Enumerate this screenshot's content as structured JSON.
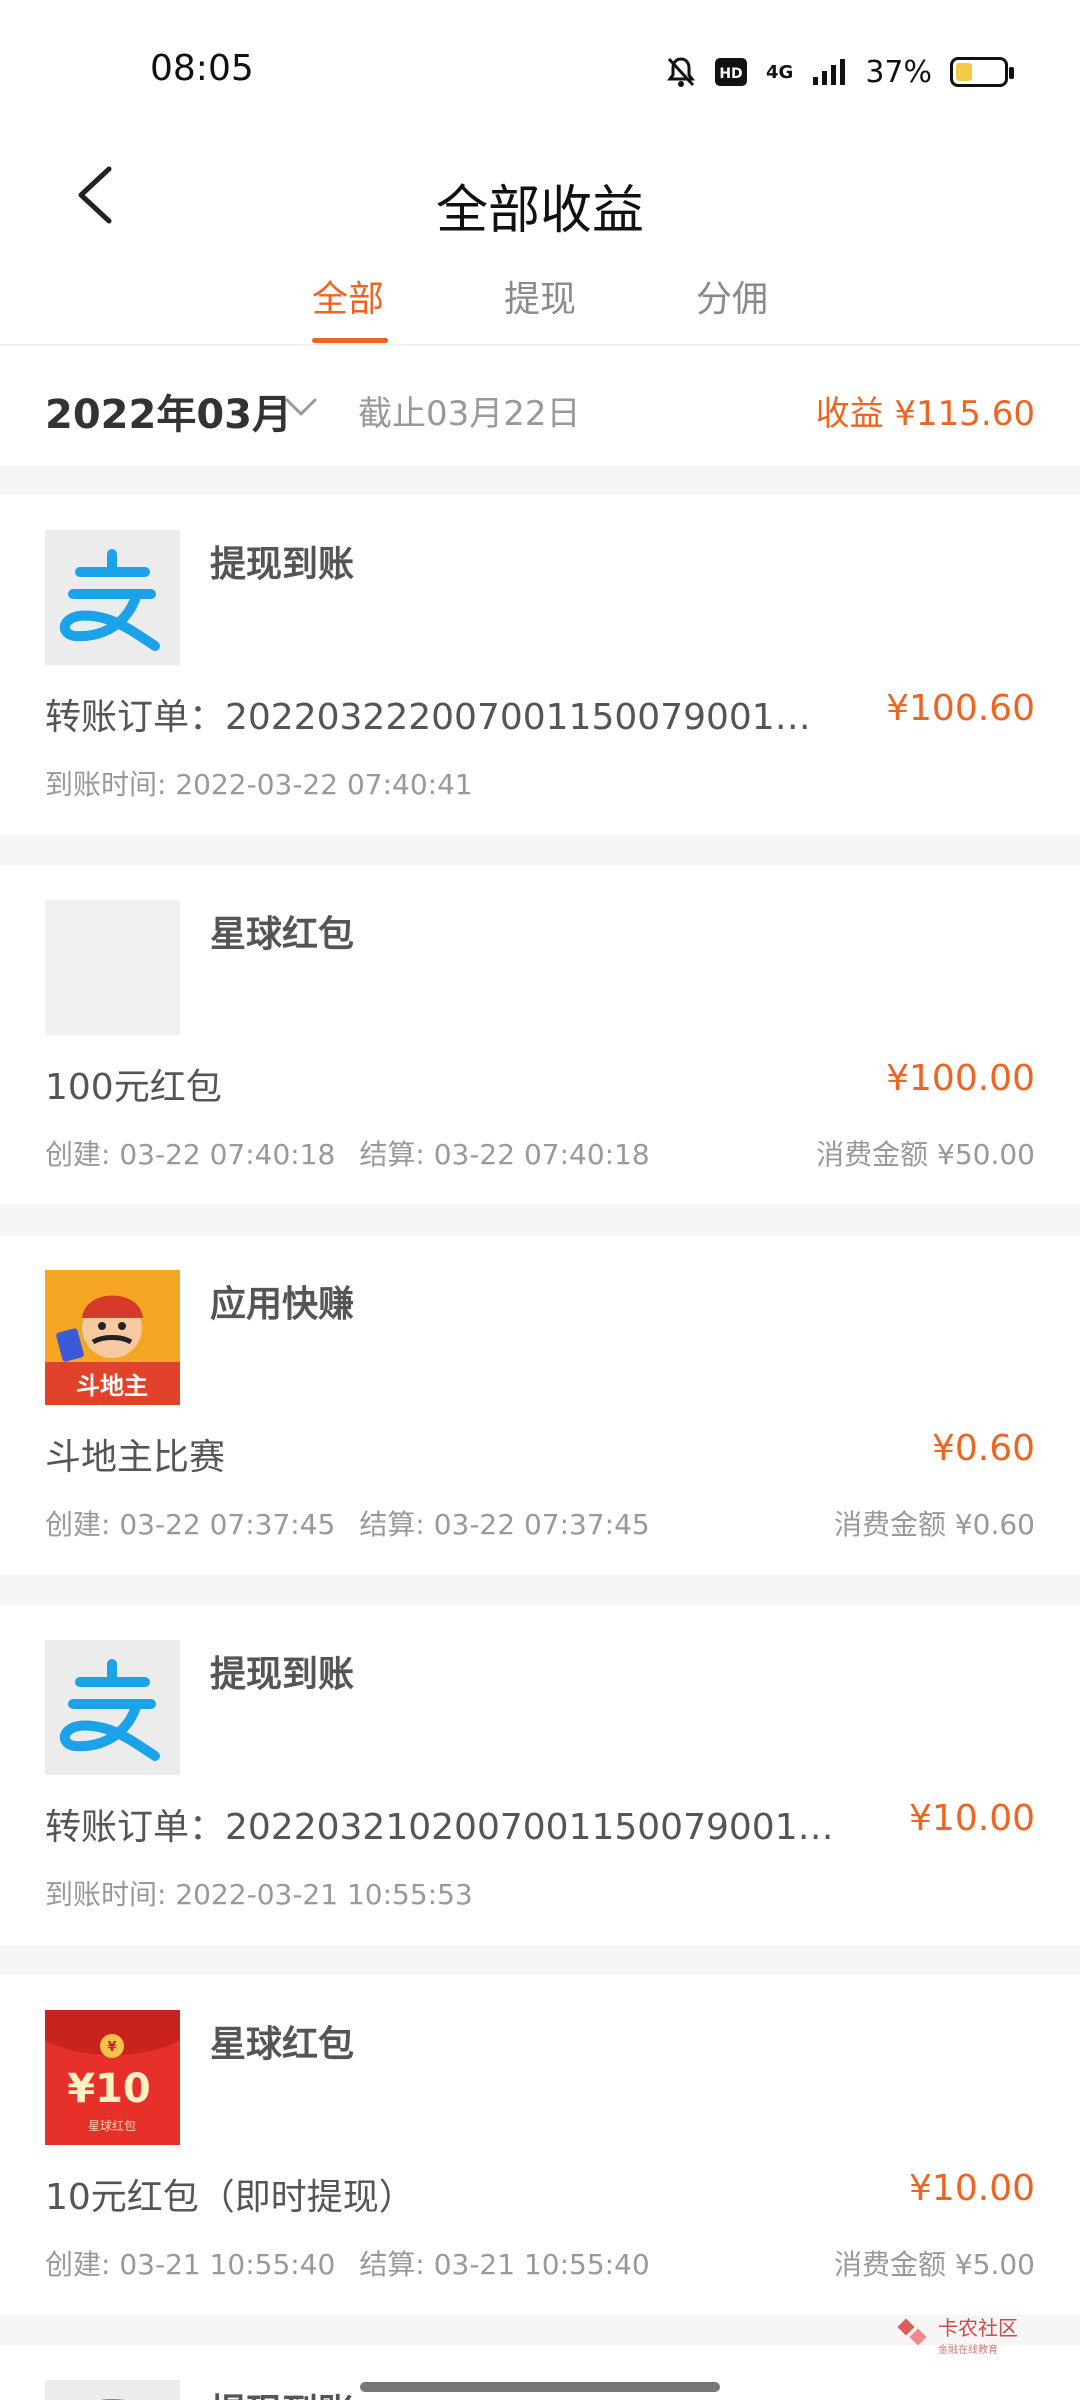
{
  "status_bar": {
    "time": "08:05",
    "network": "4G",
    "battery": "37%",
    "icons": [
      "bell-off-icon",
      "hd-icon",
      "signal-icon",
      "battery-icon"
    ]
  },
  "header": {
    "title": "全部收益",
    "back_icon": "chevron-left-icon"
  },
  "tabs": [
    {
      "label": "全部",
      "active": true
    },
    {
      "label": "提现",
      "active": false
    },
    {
      "label": "分佣",
      "active": false
    }
  ],
  "summary": {
    "month": "2022年03月",
    "until": "截止03月22日",
    "income": "收益 ¥115.60",
    "chevron_icon": "chevron-down-icon"
  },
  "records": [
    {
      "icon": "alipay-icon",
      "title": "提现到账",
      "desc": "转账订单：20220322200700115007900​1…",
      "amount": "¥100.60",
      "meta": "到账时间: 2022-03-22 07:40:41"
    },
    {
      "icon": "placeholder-image",
      "title": "星球红包",
      "desc": "100元红包",
      "amount": "¥100.00",
      "created": "创建: 03-22 07:40:18",
      "settled": "结算: 03-22 07:40:18",
      "consume": "消费金额 ¥50.00"
    },
    {
      "icon": "doudizhu-icon",
      "title": "应用快赚",
      "desc": "斗地主比赛",
      "amount": "¥0.60",
      "created": "创建: 03-22 07:37:45",
      "settled": "结算: 03-22 07:37:45",
      "consume": "消费金额 ¥0.60"
    },
    {
      "icon": "alipay-icon",
      "title": "提现到账",
      "desc": "转账订单：20220321020070011500790014…",
      "amount": "¥10.00",
      "meta": "到账时间: 2022-03-21 10:55:53"
    },
    {
      "icon": "red-envelope-icon",
      "icon_label": "¥10",
      "icon_sub": "星球红包",
      "title": "星球红包",
      "desc": "10元红包（即时提现）",
      "amount": "¥10.00",
      "created": "创建: 03-21 10:55:40",
      "settled": "结算: 03-21 10:55:40",
      "consume": "消费金额 ¥5.00"
    },
    {
      "icon": "alipay-icon",
      "title": "提现到账"
    }
  ],
  "watermark": {
    "brand": "卡农社区",
    "sub": "金融在线教育"
  },
  "colors": {
    "accent": "#ef6420",
    "alipay_blue": "#1aa3e8",
    "red_envelope": "#e8302a"
  }
}
